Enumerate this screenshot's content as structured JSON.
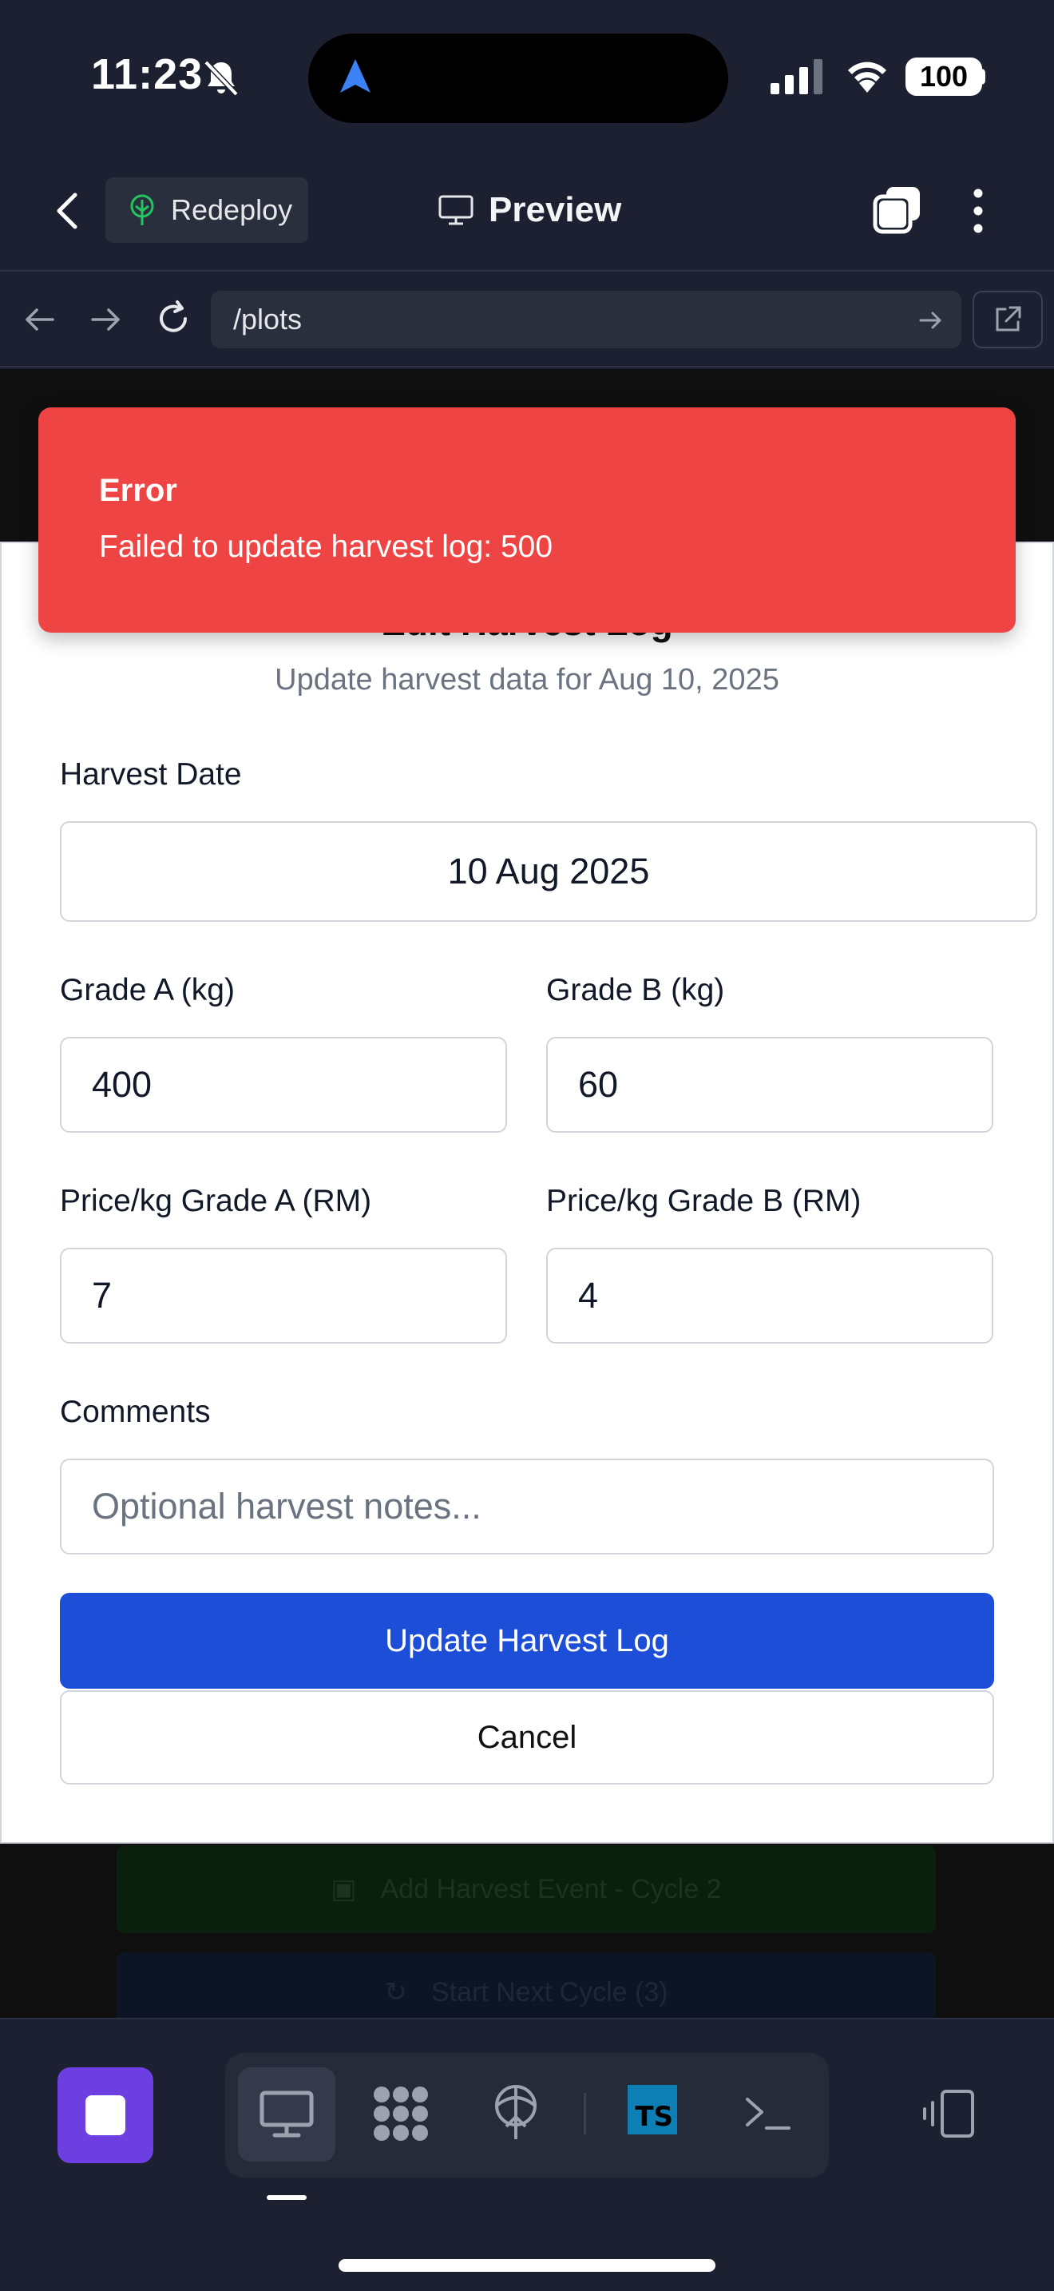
{
  "status_bar": {
    "time": "11:23",
    "battery": "100"
  },
  "app_header": {
    "redeploy_label": "Redeploy",
    "title": "Preview"
  },
  "url_bar": {
    "url": "/plots"
  },
  "toast": {
    "title": "Error",
    "message": "Failed to update harvest log: 500",
    "color": "#ef4444"
  },
  "modal": {
    "title": "Edit Harvest Log",
    "subtitle": "Update harvest data for Aug 10, 2025",
    "fields": {
      "harvest_date": {
        "label": "Harvest Date",
        "value": "10 Aug 2025"
      },
      "grade_a": {
        "label": "Grade A (kg)",
        "value": "400"
      },
      "grade_b": {
        "label": "Grade B (kg)",
        "value": "60"
      },
      "price_a": {
        "label": "Price/kg Grade A (RM)",
        "value": "7"
      },
      "price_b": {
        "label": "Price/kg Grade B (RM)",
        "value": "4"
      },
      "comments": {
        "label": "Comments",
        "placeholder": "Optional harvest notes..."
      }
    },
    "update_label": "Update Harvest Log",
    "cancel_label": "Cancel",
    "accent": "#1d4ed8"
  },
  "background": {
    "add_harvest_label": "Add Harvest Event - Cycle 2",
    "next_cycle_label": "Start Next Cycle (3)"
  },
  "dock": {
    "items": [
      "desktop-icon",
      "dots-grid-icon",
      "deploy-icon",
      "typescript-icon",
      "terminal-icon"
    ],
    "ts_label": "TS",
    "stop_color": "#6d3fe0"
  }
}
